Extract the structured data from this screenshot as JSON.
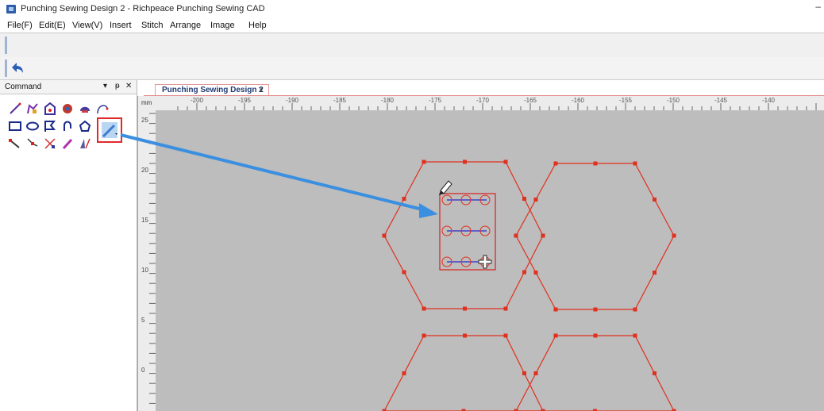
{
  "window": {
    "title": "Punching Sewing Design 2 - Richpeace Punching Sewing CAD",
    "minimize_glyph": "–"
  },
  "menu": {
    "items": [
      "File(F)",
      "Edit(E)",
      "View(V)",
      "Insert",
      "Stitch",
      "Arrange",
      "Image",
      "Help"
    ]
  },
  "toolbar": {
    "undo_icon": "undo-arrow-icon"
  },
  "command_panel": {
    "title": "Command",
    "pin_glyph": "▾",
    "dock_glyph": "ᵽ",
    "close_glyph": "✕",
    "tools": [
      "line-tool-icon",
      "polyline-tool-icon",
      "shape-tool-icon",
      "gear-tool-icon",
      "helmet-tool-icon",
      "curve-tool-icon",
      "rectangle-tool-icon",
      "ellipse-tool-icon",
      "flag-tool-icon",
      "arc-tool-icon",
      "polygon-tool-icon",
      "punch-sewing-tool-icon",
      "node-tool-icon",
      "edit-tool-icon",
      "cut-tool-icon",
      "pen-tool-icon",
      "mirror-tool-icon"
    ],
    "selected_tool": "punch-sewing-tool-icon"
  },
  "document": {
    "tab_label": "Punching Sewing Design 2",
    "tab_close": "x",
    "ruler_unit": "mm",
    "ruler_top_labels": [
      "-200",
      "-195",
      "-190",
      "-185",
      "-180",
      "-175",
      "-170",
      "-165",
      "-160",
      "-155",
      "-150",
      "-145",
      "-140"
    ],
    "ruler_left_labels": [
      "25",
      "20",
      "15",
      "10",
      "5",
      "0"
    ]
  },
  "colors": {
    "outline": "#e0301e",
    "selection_box": "#d92020",
    "stitch_line": "#2a2ad0",
    "arrow": "#3b8fe0",
    "canvas": "#bdbdbd"
  }
}
